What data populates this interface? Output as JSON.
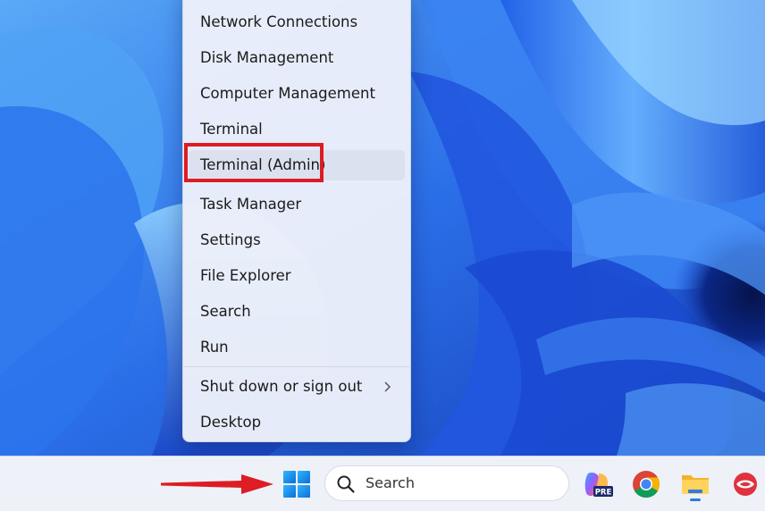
{
  "context_menu": {
    "items": [
      {
        "label": "Network Connections"
      },
      {
        "label": "Disk Management"
      },
      {
        "label": "Computer Management"
      },
      {
        "label": "Terminal"
      },
      {
        "label": "Terminal (Admin)"
      },
      {
        "label": "Task Manager"
      },
      {
        "label": "Settings"
      },
      {
        "label": "File Explorer"
      },
      {
        "label": "Search"
      },
      {
        "label": "Run"
      },
      {
        "label": "Shut down or sign out"
      },
      {
        "label": "Desktop"
      }
    ],
    "highlighted_item": "Terminal (Admin)",
    "submenu_chevron": "chevron-right-icon"
  },
  "taskbar": {
    "search_label": "Search",
    "copilot_badge": "PRE",
    "icons": [
      "windows-start-icon",
      "search-icon",
      "copilot-icon",
      "chrome-icon",
      "file-explorer-icon",
      "app-icon"
    ]
  },
  "annotations": {
    "highlight_color": "#dd1c24",
    "arrow_color": "#dd1c24"
  },
  "colors": {
    "accent": "#0f6cbd",
    "wallpaper_dark": "#0a1f6e",
    "wallpaper_light": "#3d8df5"
  }
}
